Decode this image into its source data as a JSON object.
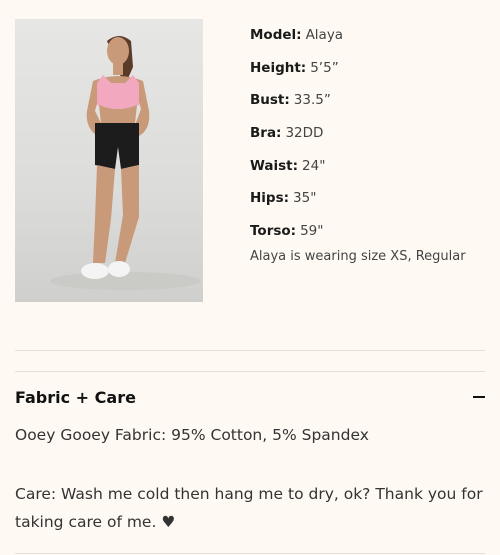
{
  "model_image": {
    "alt": "Model wearing pink sports bra and black shorts",
    "colors": {
      "background": "#dcdcda",
      "top": "#f2a9c0",
      "shorts": "#1c1c1c",
      "skin": "#c99a7a",
      "hair": "#5a3b28",
      "shoes": "#f4f4f4"
    }
  },
  "measurements": [
    {
      "label": "Model:",
      "value": "Alaya"
    },
    {
      "label": "Height:",
      "value": "5’5”"
    },
    {
      "label": "Bust:",
      "value": "33.5”"
    },
    {
      "label": "Bra:",
      "value": "32DD"
    },
    {
      "label": "Waist:",
      "value": "24\""
    },
    {
      "label": "Hips:",
      "value": "35\""
    },
    {
      "label": "Torso:",
      "value": "59\""
    }
  ],
  "wearing_note": "Alaya is wearing size XS, Regular",
  "fabric_care": {
    "title": "Fabric + Care",
    "toggle_icon": "minus-icon",
    "fabric": "Ooey Gooey Fabric: 95% Cotton, 5% Spandex",
    "care": "Care: Wash me cold then hang me to dry, ok? Thank you for taking care of me. ♥"
  },
  "colors": {
    "page_background": "#fefaf3",
    "divider": "#e6e0d6",
    "text_primary": "#1a1a1a",
    "text_secondary": "#444444"
  }
}
